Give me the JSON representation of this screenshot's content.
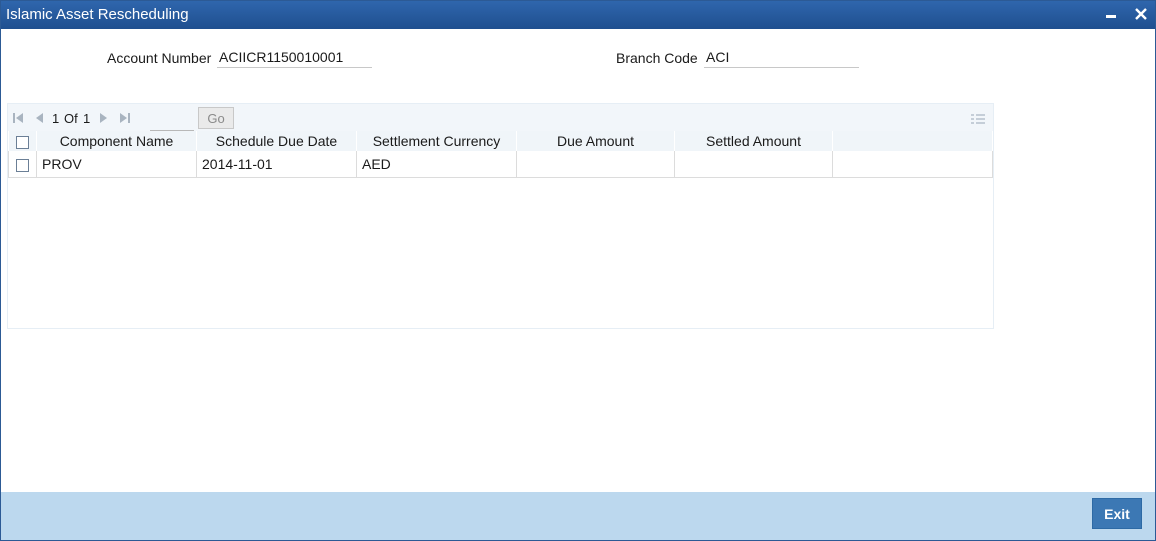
{
  "window": {
    "title": "Islamic Asset Rescheduling"
  },
  "fields": {
    "account_number_label": "Account Number",
    "account_number_value": "ACIICR1150010001",
    "branch_code_label": "Branch Code",
    "branch_code_value": "ACI"
  },
  "pager": {
    "current": "1",
    "of_label": "Of",
    "total": "1",
    "go_label": "Go",
    "page_input": ""
  },
  "grid": {
    "columns": [
      "Component Name",
      "Schedule Due Date",
      "Settlement Currency",
      "Due Amount",
      "Settled Amount"
    ],
    "rows": [
      {
        "component_name": "PROV",
        "schedule_due_date": "2014-11-01",
        "settlement_currency": "AED",
        "due_amount": "",
        "settled_amount": ""
      }
    ]
  },
  "footer": {
    "exit_label": "Exit"
  },
  "colors": {
    "titlebar": "#2a5fa3",
    "footer": "#bcd8ee",
    "exit_button": "#3c78b4"
  }
}
